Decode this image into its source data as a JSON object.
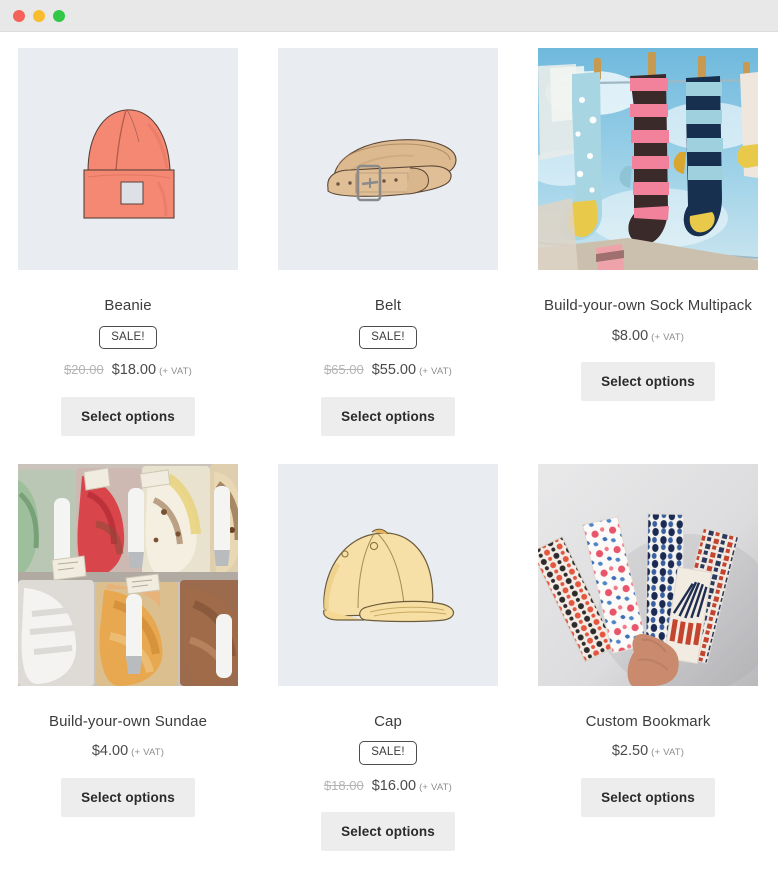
{
  "window": {
    "traffic_lights": [
      {
        "name": "close",
        "color": "#f4625a"
      },
      {
        "name": "minimize",
        "color": "#f7bd2e"
      },
      {
        "name": "maximize",
        "color": "#33c748"
      }
    ]
  },
  "labels": {
    "sale_badge": "SALE!",
    "select_options": "Select options",
    "vat_note": "(+ VAT)"
  },
  "products": [
    {
      "name": "Beanie",
      "image": "beanie-illustration",
      "image_kind": "illustration",
      "on_sale": true,
      "price_old": "$20.00",
      "price_new": "$18.00",
      "vat": "(+ VAT)",
      "button": "Select options"
    },
    {
      "name": "Belt",
      "image": "belt-illustration",
      "image_kind": "illustration",
      "on_sale": true,
      "price_old": "$65.00",
      "price_new": "$55.00",
      "vat": "(+ VAT)",
      "button": "Select options"
    },
    {
      "name": "Build-your-own Sock Multipack",
      "image": "socks-on-clothesline-photo",
      "image_kind": "photo",
      "on_sale": false,
      "price_old": "",
      "price_new": "$8.00",
      "vat": "(+ VAT)",
      "button": "Select options"
    },
    {
      "name": "Build-your-own Sundae",
      "image": "gelato-display-photo",
      "image_kind": "photo",
      "on_sale": false,
      "price_old": "",
      "price_new": "$4.00",
      "vat": "(+ VAT)",
      "button": "Select options"
    },
    {
      "name": "Cap",
      "image": "cap-illustration",
      "image_kind": "illustration",
      "on_sale": true,
      "price_old": "$18.00",
      "price_new": "$16.00",
      "vat": "(+ VAT)",
      "button": "Select options"
    },
    {
      "name": "Custom Bookmark",
      "image": "patterned-bookmarks-photo",
      "image_kind": "photo",
      "on_sale": false,
      "price_old": "",
      "price_new": "$2.50",
      "vat": "(+ VAT)",
      "button": "Select options"
    }
  ],
  "colors": {
    "thumb_background": "#e9edf2",
    "button_background": "#ededed",
    "title_text": "#3c3c3c",
    "price_text": "#4a4a4a",
    "price_old_text": "#b5b5b5",
    "titlebar": "#e8e8e8"
  }
}
